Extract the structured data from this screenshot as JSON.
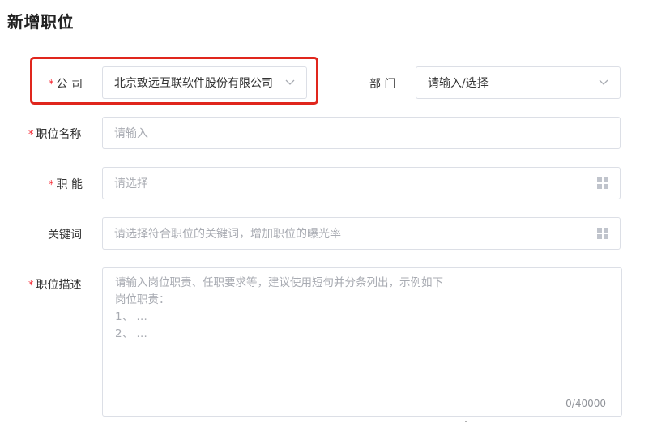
{
  "page": {
    "title": "新增职位"
  },
  "form": {
    "required_mark": "*",
    "company": {
      "label": "公 司",
      "value": "北京致远互联软件股份有限公司"
    },
    "department": {
      "label": "部 门",
      "placeholder": "请输入/选择"
    },
    "position_name": {
      "label": "职位名称",
      "placeholder": "请输入"
    },
    "function": {
      "label": "职 能",
      "placeholder": "请选择"
    },
    "keywords": {
      "label": "关键词",
      "placeholder": "请选择符合职位的关键词，增加职位的曝光率"
    },
    "description": {
      "label": "职位描述",
      "placeholder_lines": [
        "请输入岗位职责、任职要求等，建议使用短句并分条列出，示例如下",
        "岗位职责：",
        "1、 …",
        "2、 …"
      ],
      "counter": "0/40000"
    }
  },
  "colors": {
    "highlight": "#e0261d",
    "required": "#f5222d",
    "border": "#dcdfe6",
    "placeholder": "#a8abb2"
  },
  "icons": {
    "select_arrow": "chevron-down-icon",
    "picker": "grid-icon"
  }
}
